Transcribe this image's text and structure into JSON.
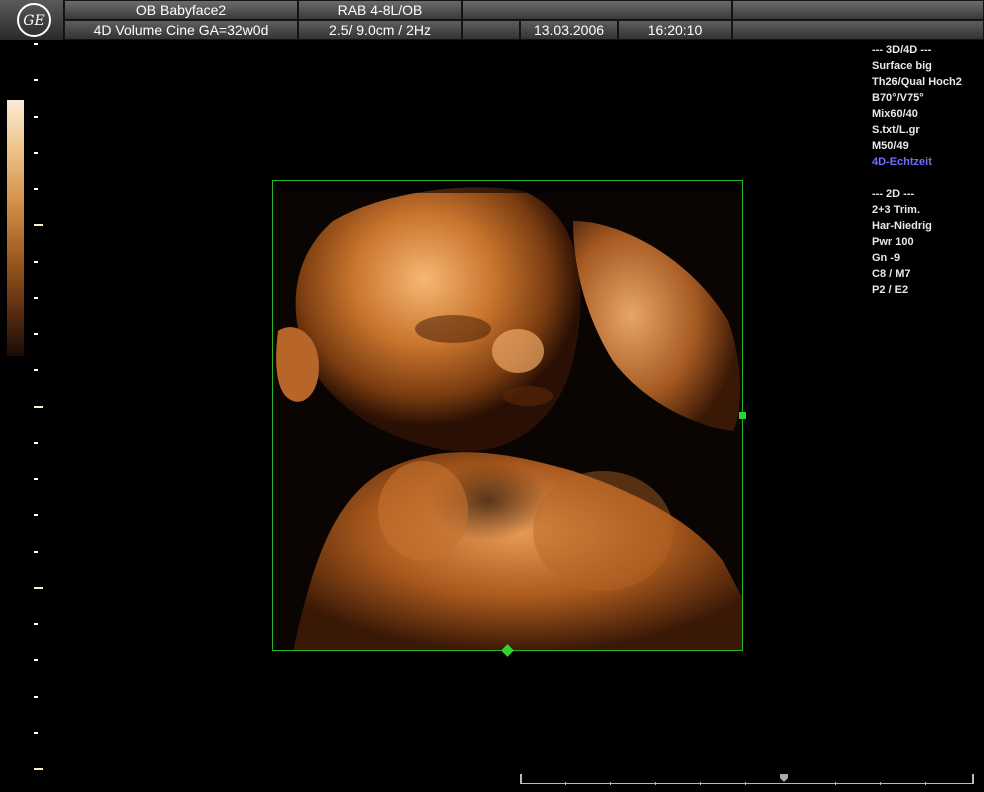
{
  "header": {
    "logo_icon": "ge-logo-icon",
    "preset": "OB Babyface2",
    "mode": "4D Volume Cine  GA=32w0d",
    "probe": "RAB 4-8L/OB",
    "probe_settings": "2.5/ 9.0cm / 2Hz",
    "date": "13.03.2006",
    "time": "16:20:10"
  },
  "params": {
    "section_3d4d": "--- 3D/4D ---",
    "surface": "Surface big",
    "quality": "Th26/Qual Hoch2",
    "angle": "B70°/V75°",
    "mix": "Mix60/40",
    "texture": "S.txt/L.gr",
    "m": "M50/49",
    "realtime": "4D-Echtzeit",
    "section_2d": "--- 2D ---",
    "trim": "2+3 Trim.",
    "harmonic": "Har-Niedrig",
    "power": "Pwr 100",
    "gain": "Gn  -9",
    "c_m": "C8 / M7",
    "p_e": "P2 / E2"
  },
  "colors": {
    "roi_border": "#27b427",
    "realtime_text": "#6f6fff",
    "tint_light": "#fbecd6",
    "tint_dark": "#1a0b04"
  }
}
